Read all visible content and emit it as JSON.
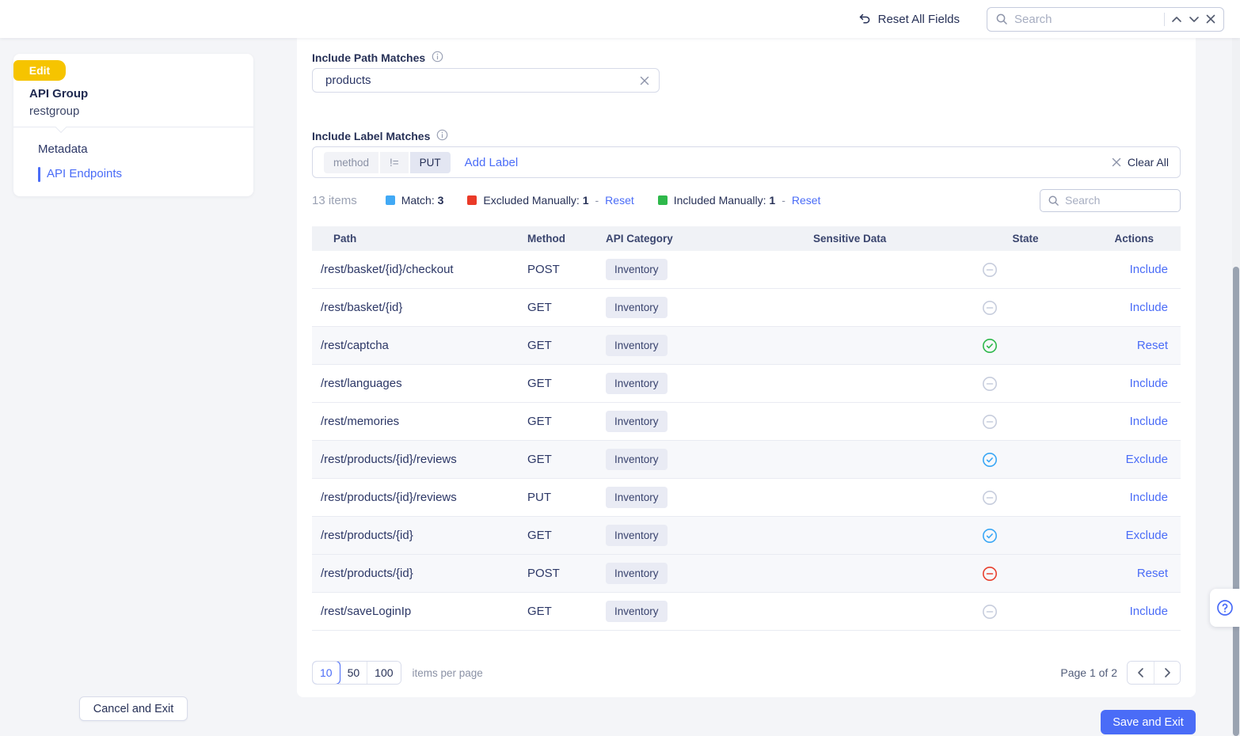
{
  "topbar": {
    "reset_all_label": "Reset All Fields",
    "search_placeholder": "Search"
  },
  "sidebar": {
    "badge": "Edit",
    "title": "API Group",
    "subtitle": "restgroup",
    "items": [
      {
        "label": "Metadata",
        "active": false
      },
      {
        "label": "API Endpoints",
        "active": true
      }
    ]
  },
  "filters": {
    "path_label": "Include Path Matches",
    "path_value": "products",
    "label_label": "Include Label Matches",
    "label_chip": {
      "key": "method",
      "op": "!=",
      "value": "PUT"
    },
    "add_label": "Add Label",
    "clear_all": "Clear All"
  },
  "toolbar": {
    "items_count": "13 items",
    "legend": [
      {
        "label": "Match:",
        "count": "3",
        "color": "#41a9f5",
        "reset": null
      },
      {
        "label": "Excluded Manually:",
        "count": "1",
        "color": "#ea3a28",
        "reset": "Reset"
      },
      {
        "label": "Included Manually:",
        "count": "1",
        "color": "#2eb84b",
        "reset": "Reset"
      }
    ],
    "search_placeholder": "Search"
  },
  "table": {
    "columns": [
      "Path",
      "Method",
      "API Category",
      "Sensitive Data",
      "State",
      "Actions"
    ],
    "state_colors": {
      "none": "#c7cddd",
      "match": "#3aa7f5",
      "included": "#2eb84b",
      "excluded": "#e8402e"
    },
    "rows": [
      {
        "path": "/rest/basket/{id}/checkout",
        "method": "POST",
        "category": "Inventory",
        "sensitive": "",
        "state": "none",
        "action": "Include",
        "highlight": false
      },
      {
        "path": "/rest/basket/{id}",
        "method": "GET",
        "category": "Inventory",
        "sensitive": "",
        "state": "none",
        "action": "Include",
        "highlight": false
      },
      {
        "path": "/rest/captcha",
        "method": "GET",
        "category": "Inventory",
        "sensitive": "",
        "state": "included",
        "action": "Reset",
        "highlight": true
      },
      {
        "path": "/rest/languages",
        "method": "GET",
        "category": "Inventory",
        "sensitive": "",
        "state": "none",
        "action": "Include",
        "highlight": false
      },
      {
        "path": "/rest/memories",
        "method": "GET",
        "category": "Inventory",
        "sensitive": "",
        "state": "none",
        "action": "Include",
        "highlight": false
      },
      {
        "path": "/rest/products/{id}/reviews",
        "method": "GET",
        "category": "Inventory",
        "sensitive": "",
        "state": "match",
        "action": "Exclude",
        "highlight": true
      },
      {
        "path": "/rest/products/{id}/reviews",
        "method": "PUT",
        "category": "Inventory",
        "sensitive": "",
        "state": "none",
        "action": "Include",
        "highlight": false
      },
      {
        "path": "/rest/products/{id}",
        "method": "GET",
        "category": "Inventory",
        "sensitive": "",
        "state": "match",
        "action": "Exclude",
        "highlight": true
      },
      {
        "path": "/rest/products/{id}",
        "method": "POST",
        "category": "Inventory",
        "sensitive": "",
        "state": "excluded",
        "action": "Reset",
        "highlight": true
      },
      {
        "path": "/rest/saveLoginIp",
        "method": "GET",
        "category": "Inventory",
        "sensitive": "",
        "state": "none",
        "action": "Include",
        "highlight": false
      }
    ]
  },
  "pagination": {
    "sizes": [
      "10",
      "50",
      "100"
    ],
    "active_size": "10",
    "per_page_label": "items per page",
    "page_label": "Page 1 of 2"
  },
  "footer": {
    "cancel_label": "Cancel and Exit",
    "save_label": "Save and Exit"
  },
  "colors": {
    "accent_blue": "#4a6cf7",
    "badge_yellow": "#f6c400"
  }
}
